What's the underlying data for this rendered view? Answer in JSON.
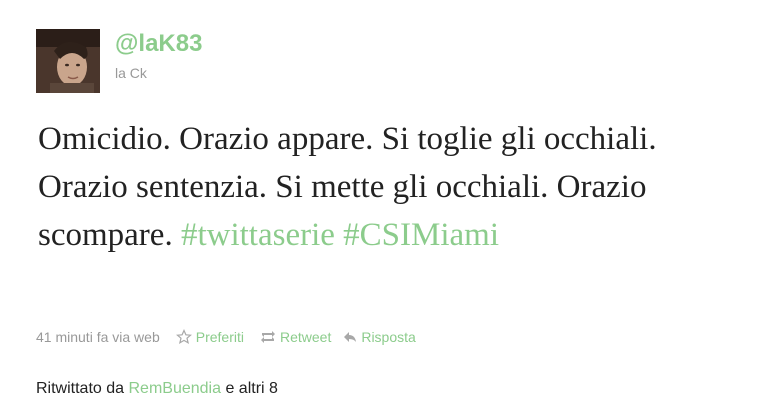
{
  "user": {
    "screen_name": "@laK83",
    "full_name": "la Ck"
  },
  "tweet": {
    "text_part1": "Omicidio. Orazio appare. Si toglie gli occhiali. Orazio sentenzia. Si mette gli occhiali. Orazio scompare.",
    "hashtag1": "#twittaserie",
    "hashtag2": "#CSIMiami"
  },
  "meta": {
    "time": "41 minuti fa via web",
    "favorite_label": "Preferiti",
    "retweet_label": "Retweet",
    "reply_label": "Risposta"
  },
  "retweeted": {
    "prefix": "Ritwittato da",
    "user": "RemBuendia",
    "suffix": "e altri 8"
  },
  "colors": {
    "link": "#8ccc8c",
    "text": "#222222",
    "muted": "#999999"
  },
  "icons": [
    "star-icon",
    "retweet-icon",
    "reply-icon"
  ]
}
